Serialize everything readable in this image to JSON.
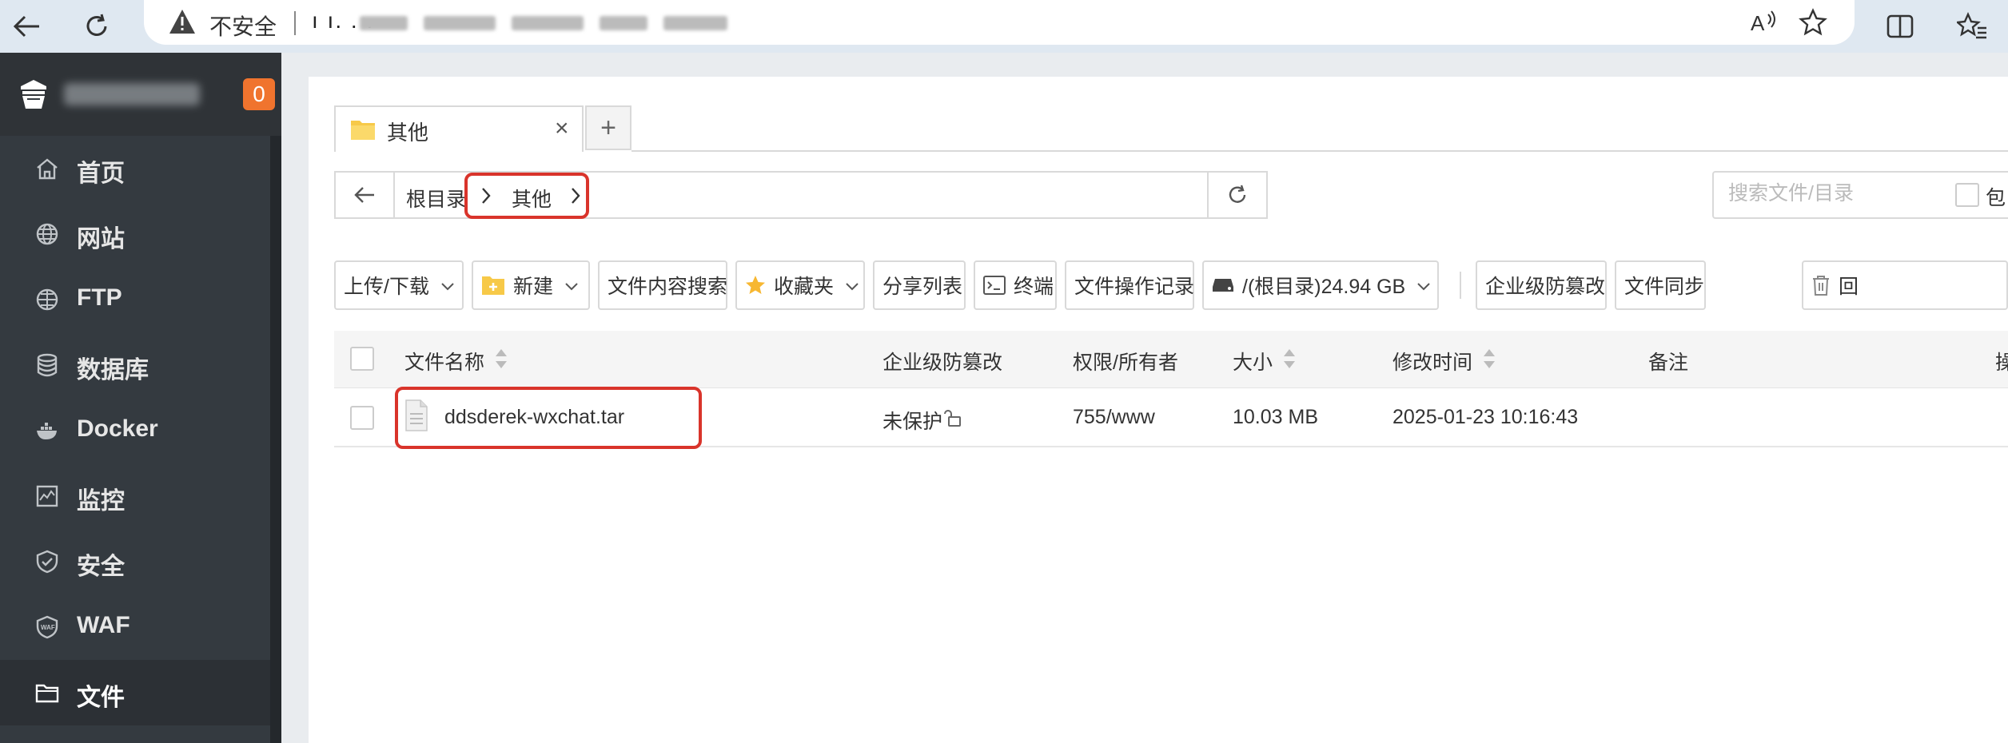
{
  "browser": {
    "insecure_label": "不安全",
    "url_visible": "ı ı. . ."
  },
  "sidebar": {
    "badge": "0",
    "items": [
      {
        "label": "首页",
        "icon": "home-icon"
      },
      {
        "label": "网站",
        "icon": "globe-icon"
      },
      {
        "label": "FTP",
        "icon": "ftp-icon"
      },
      {
        "label": "数据库",
        "icon": "database-icon"
      },
      {
        "label": "Docker",
        "icon": "docker-icon"
      },
      {
        "label": "监控",
        "icon": "monitor-icon"
      },
      {
        "label": "安全",
        "icon": "shield-icon"
      },
      {
        "label": "WAF",
        "icon": "waf-icon"
      },
      {
        "label": "文件",
        "icon": "folder-icon",
        "active": true
      }
    ]
  },
  "tabs": {
    "active_label": "其他",
    "add_label": "+",
    "close_label": "×"
  },
  "path": {
    "crumbs": [
      "根目录",
      "其他"
    ]
  },
  "search": {
    "placeholder": "搜索文件/目录",
    "checkbox_label": "包"
  },
  "toolbar": {
    "upload_download": "上传/下载",
    "new": "新建",
    "content_search": "文件内容搜索",
    "favorites": "收藏夹",
    "share_list": "分享列表",
    "terminal": "终端",
    "operation_log": "文件操作记录",
    "disk": "/(根目录)24.94 GB",
    "tamper_protect": "企业级防篡改",
    "file_sync": "文件同步",
    "recycle": "回"
  },
  "table": {
    "headers": {
      "name": "文件名称",
      "tamper": "企业级防篡改",
      "perm": "权限/所有者",
      "size": "大小",
      "mtime": "修改时间",
      "note": "备注",
      "ops": "操"
    },
    "rows": [
      {
        "name": "ddsderek-wxchat.tar",
        "tamper": "未保护",
        "perm": "755/www",
        "size": "10.03 MB",
        "mtime": "2025-01-23 10:16:43",
        "note": ""
      }
    ]
  },
  "colors": {
    "sidebar_bg": "#343a40",
    "badge": "#f0742e",
    "highlight": "#d9342b",
    "browser_bar": "#dfe8f1"
  }
}
